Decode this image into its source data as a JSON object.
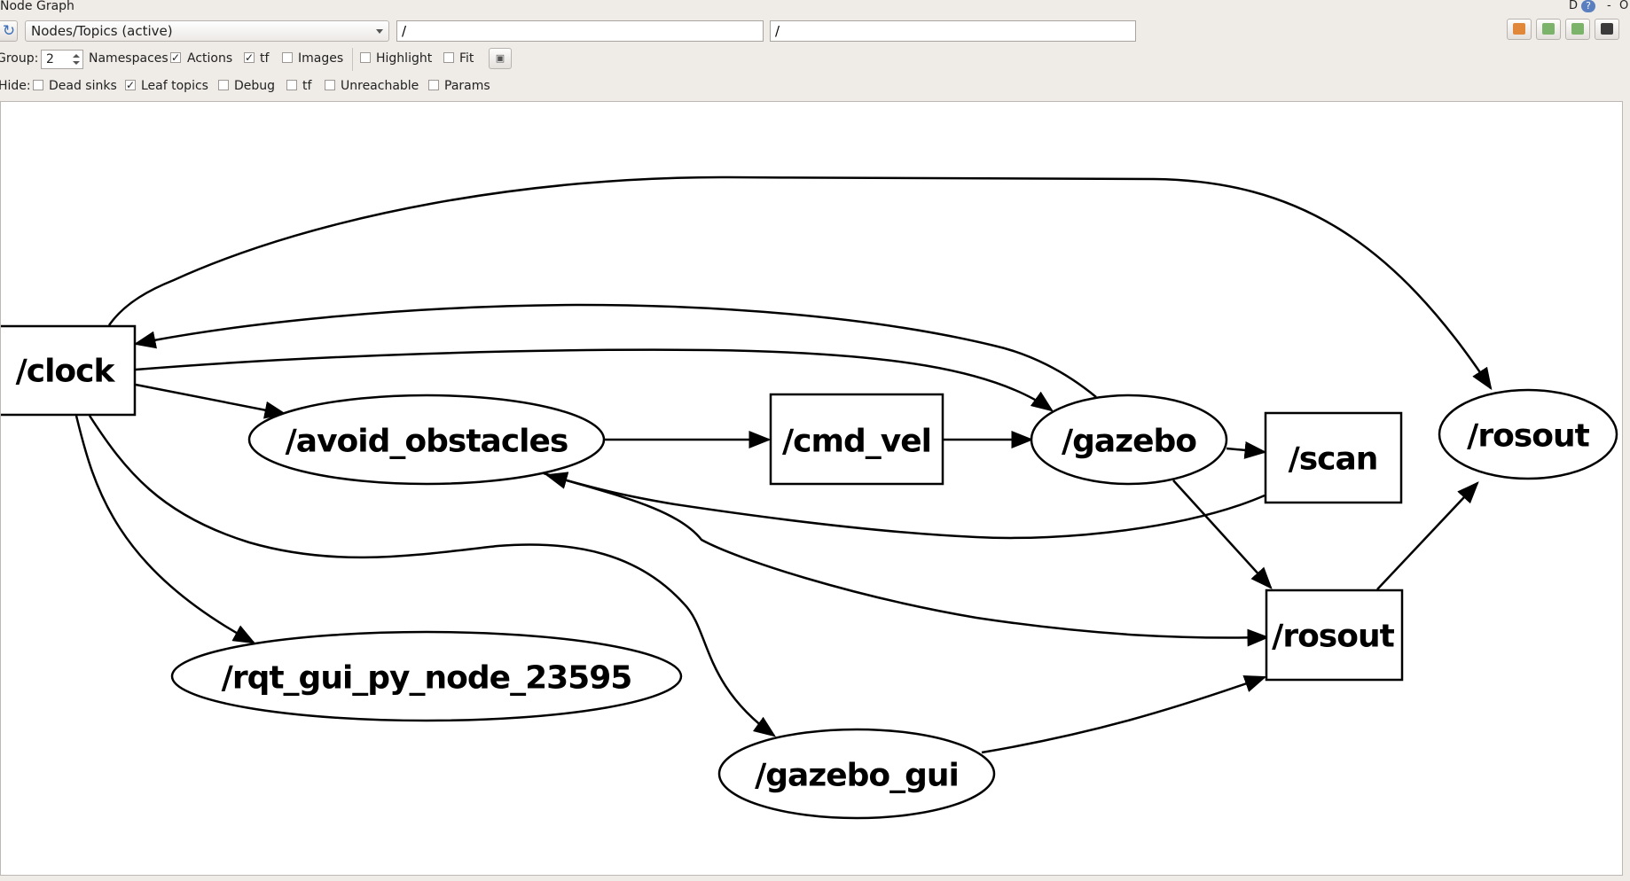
{
  "window": {
    "title": "Node Graph",
    "controls_d": "D",
    "controls_help": "?",
    "controls_min": "-",
    "controls_close": "O"
  },
  "toolbar": {
    "mode_selected": "Nodes/Topics (active)",
    "node_filter": "/",
    "topic_filter": "/"
  },
  "group_row": {
    "group_label": "Group:",
    "group_value": "2",
    "namespaces": "Namespaces",
    "actions": {
      "label": "Actions",
      "checked": true
    },
    "tf": {
      "label": "tf",
      "checked": true
    },
    "images": {
      "label": "Images",
      "checked": false
    },
    "highlight": {
      "label": "Highlight",
      "checked": false
    },
    "fit": {
      "label": "Fit",
      "checked": false
    }
  },
  "hide_row": {
    "hide_label": "Hide:",
    "dead_sinks": {
      "label": "Dead sinks",
      "checked": false
    },
    "leaf_topics": {
      "label": "Leaf topics",
      "checked": true
    },
    "debug": {
      "label": "Debug",
      "checked": false
    },
    "tf": {
      "label": "tf",
      "checked": false
    },
    "unreachable": {
      "label": "Unreachable",
      "checked": false
    },
    "params": {
      "label": "Params",
      "checked": false
    }
  },
  "graph": {
    "nodes": {
      "clock": "/clock",
      "avoid_obstacles": "/avoid_obstacles",
      "cmd_vel": "/cmd_vel",
      "gazebo": "/gazebo",
      "scan": "/scan",
      "rosout_topic": "/rosout",
      "rosout_node": "/rosout",
      "rqt_gui": "/rqt_gui_py_node_23595",
      "gazebo_gui": "/gazebo_gui"
    }
  },
  "colors": {
    "toolbar_bg": "#efebe7",
    "canvas_bg": "#ffffff",
    "graph_stroke": "#000000"
  }
}
